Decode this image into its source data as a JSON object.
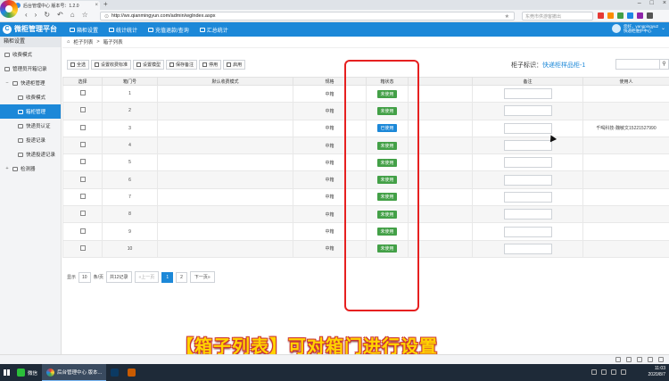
{
  "browser": {
    "tab_title": "后台管理中心 版本号：1.2.0",
    "url": "http://wx.qianmingyun.com/admin/wglndex.aspx",
    "search_placeholder": "东莞市供游客撤出"
  },
  "app": {
    "brand": "微柜管理平台",
    "nav": [
      "箱柜设置",
      "统计统计",
      "充值退款/查询",
      "汇总统计"
    ],
    "user_line1": "您好，yangpingyu2",
    "user_line2": "快递柜维护中心"
  },
  "sidebar": {
    "title": "箱柜设置",
    "items": [
      {
        "label": "收费模式",
        "toggle": ""
      },
      {
        "label": "管理员开箱记录",
        "toggle": ""
      },
      {
        "label": "快递柜管理",
        "toggle": "−"
      },
      {
        "label": "收费模式",
        "toggle": ""
      },
      {
        "label": "箱柜管理",
        "toggle": ""
      },
      {
        "label": "快递员认证",
        "toggle": ""
      },
      {
        "label": "投递记录",
        "toggle": ""
      },
      {
        "label": "快递投递记录",
        "toggle": ""
      },
      {
        "label": "检测器",
        "toggle": "+"
      }
    ]
  },
  "breadcrumb": {
    "part1": "柜子列表",
    "sep": ">",
    "part2": "箱子列表"
  },
  "toolbar": [
    "全选",
    "设置收费标准",
    "设置模型",
    "保存备注",
    "停用",
    "启用"
  ],
  "cabinet": {
    "label": "柜子标识：",
    "value": "快递柜样品柜-1"
  },
  "table": {
    "headers": [
      "选择",
      "箱门号",
      "默认收费模式",
      "规格",
      "箱状态",
      "",
      "备注",
      "使用人"
    ],
    "rows": [
      {
        "num": "1",
        "spec": "中箱",
        "status": "未使用",
        "user": ""
      },
      {
        "num": "2",
        "spec": "中箱",
        "status": "未使用",
        "user": ""
      },
      {
        "num": "3",
        "spec": "中箱",
        "status": "已使用",
        "user": "千喝科技-魏敏文15221527990"
      },
      {
        "num": "4",
        "spec": "中箱",
        "status": "未使用",
        "user": ""
      },
      {
        "num": "5",
        "spec": "中箱",
        "status": "未使用",
        "user": ""
      },
      {
        "num": "6",
        "spec": "中箱",
        "status": "未使用",
        "user": ""
      },
      {
        "num": "7",
        "spec": "中箱",
        "status": "未使用",
        "user": ""
      },
      {
        "num": "8",
        "spec": "中箱",
        "status": "未使用",
        "user": ""
      },
      {
        "num": "9",
        "spec": "中箱",
        "status": "未使用",
        "user": ""
      },
      {
        "num": "10",
        "spec": "中箱",
        "status": "未使用",
        "user": ""
      }
    ]
  },
  "pager": {
    "show": "显示",
    "per_page": "10",
    "unit": "条/页",
    "total": "共12记录",
    "prev": "«上一页",
    "page1": "1",
    "page2": "2",
    "next": "下一页»"
  },
  "caption": "【箱子列表】可对箱门进行设置",
  "taskbar": {
    "apps": [
      "微信",
      "后台管理中心 版本..."
    ],
    "time": "11:03",
    "date": "2020/8/7"
  },
  "colors": {
    "primary": "#1c88d8",
    "unused": "#43a047",
    "used": "#1c88d8",
    "highlight": "#e62020",
    "caption": "#ffd400"
  }
}
